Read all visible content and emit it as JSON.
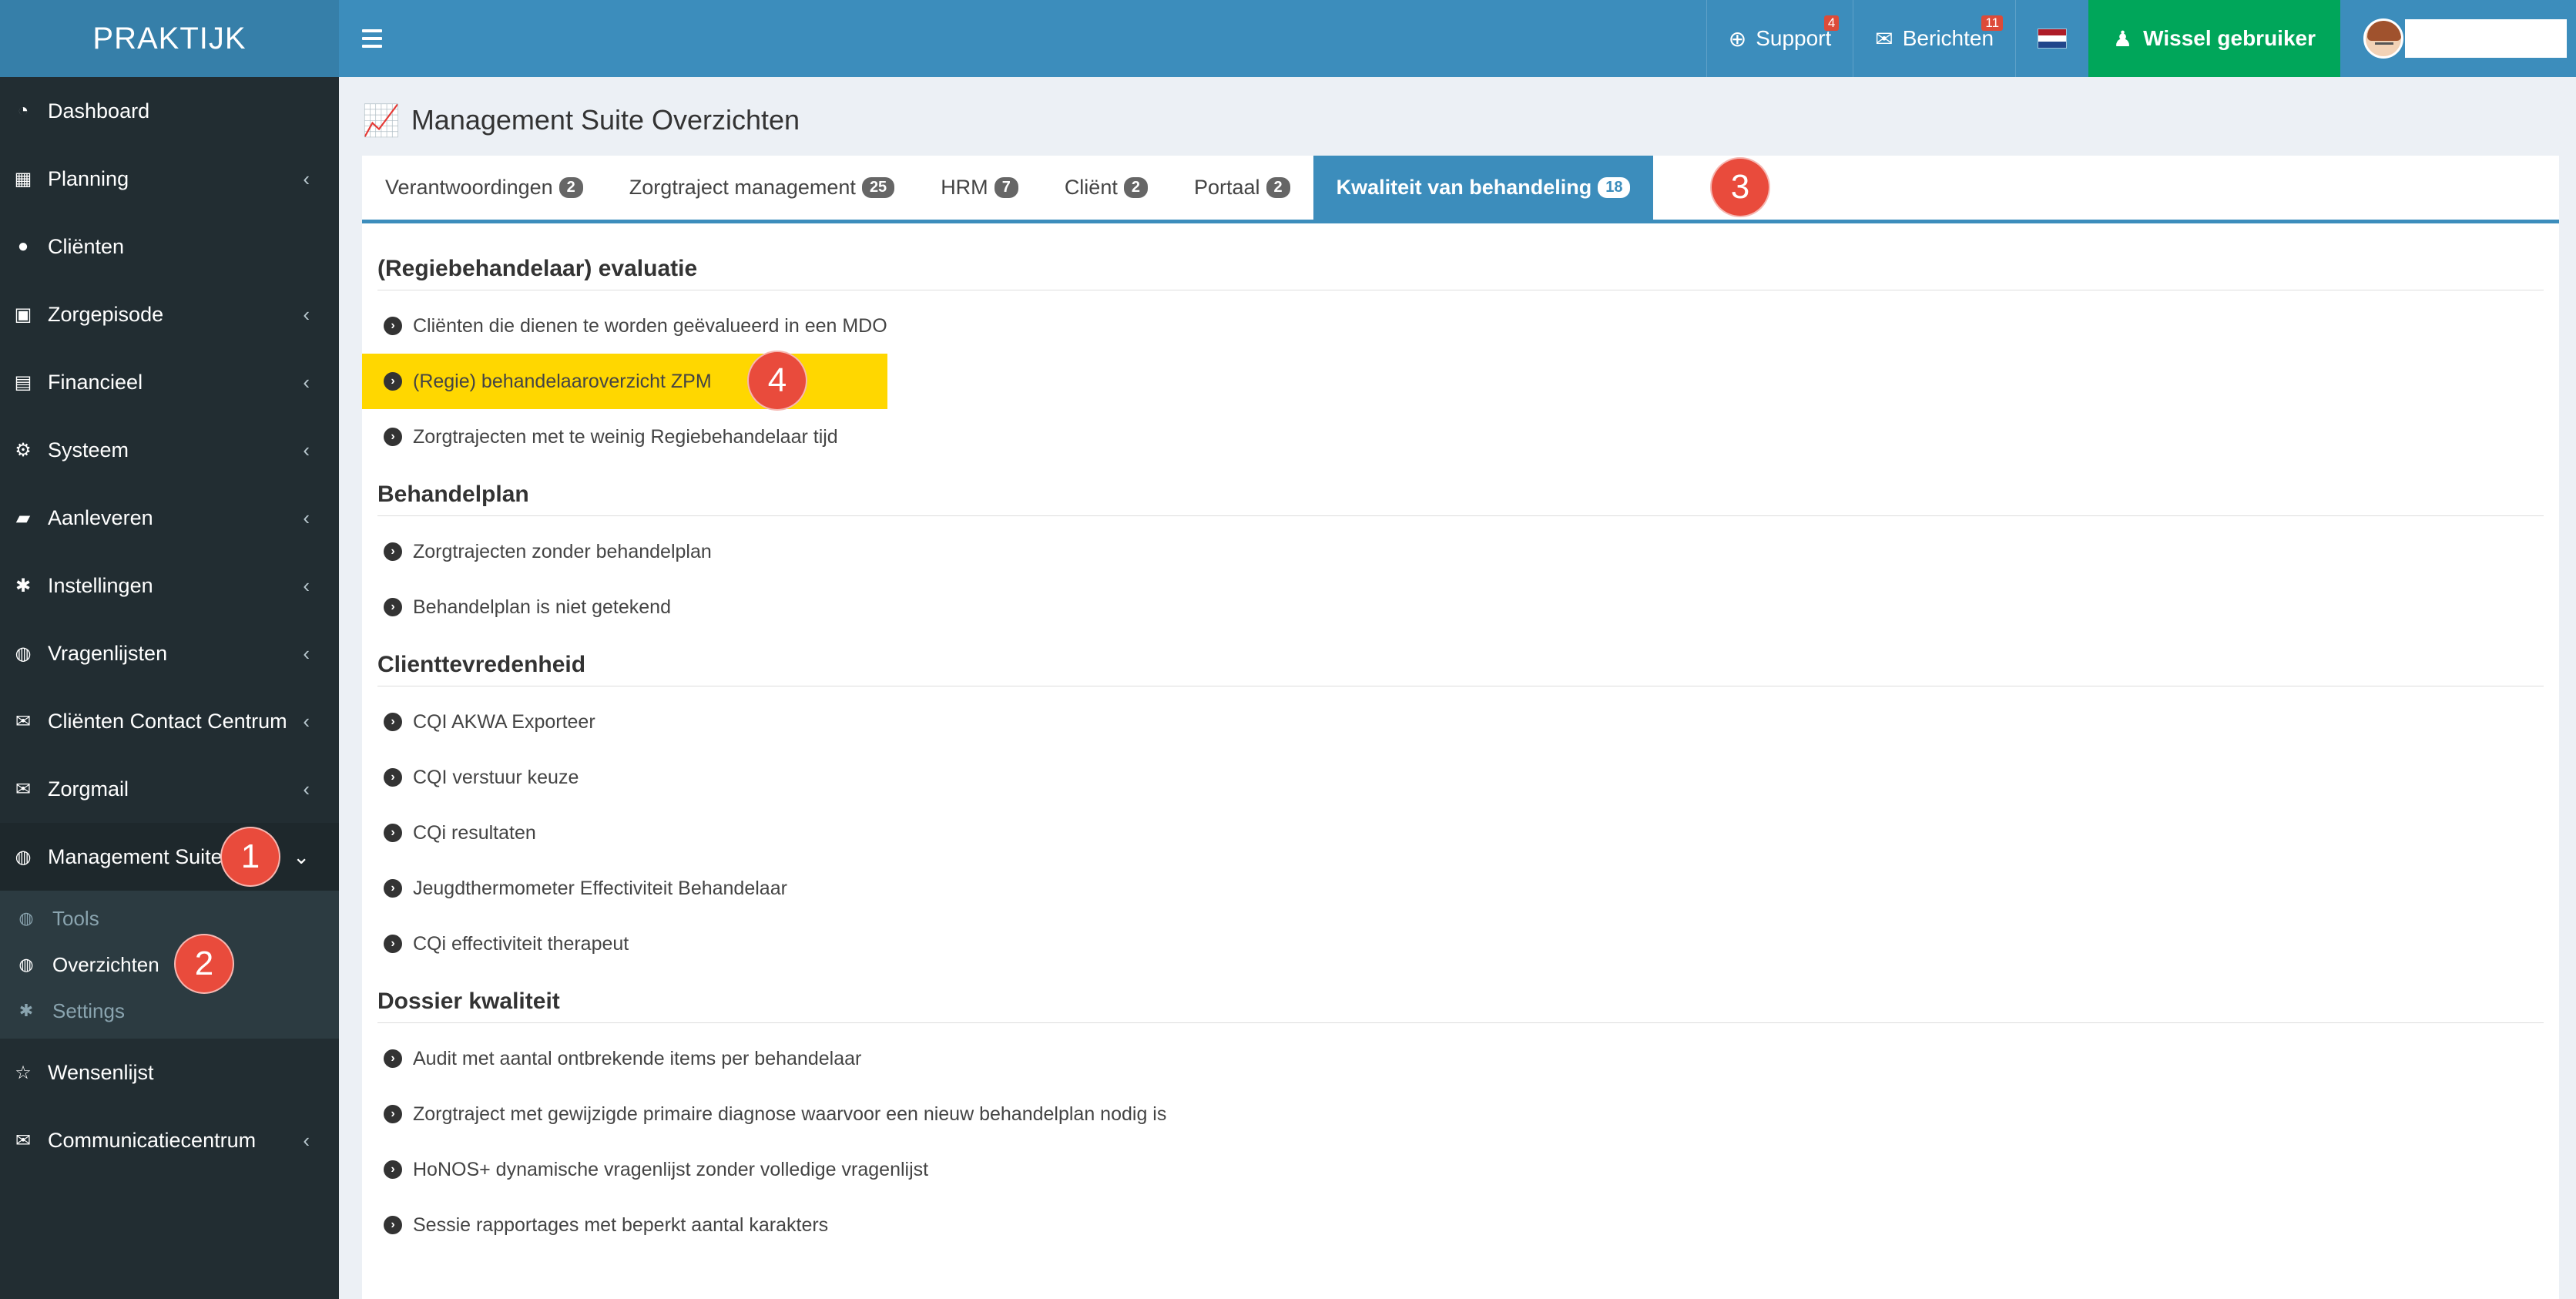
{
  "brand": "PRAKTIJK",
  "navbar": {
    "support_label": "Support",
    "support_badge": "4",
    "messages_label": "Berichten",
    "messages_badge": "11",
    "switch_user_label": "Wissel gebruiker",
    "colors": {
      "bar": "#3c8dbc",
      "switch": "#00a65a",
      "badge": "#dd4b39"
    }
  },
  "sidebar": {
    "items": [
      {
        "label": "Dashboard",
        "icon": "dashboard-icon"
      },
      {
        "label": "Planning",
        "icon": "calendar-icon"
      },
      {
        "label": "Cliënten",
        "icon": "user-icon"
      },
      {
        "label": "Zorgepisode",
        "icon": "suitcase-icon"
      },
      {
        "label": "Financieel",
        "icon": "book-icon"
      },
      {
        "label": "Systeem",
        "icon": "cogs-icon"
      },
      {
        "label": "Aanleveren",
        "icon": "truck-icon"
      },
      {
        "label": "Instellingen",
        "icon": "gear-icon"
      },
      {
        "label": "Vragenlijsten",
        "icon": "globe-icon"
      },
      {
        "label": "Cliënten Contact Centrum",
        "icon": "envelope-icon"
      },
      {
        "label": "Zorgmail",
        "icon": "envelope-icon"
      },
      {
        "label": "Management Suite",
        "icon": "globe-icon"
      }
    ],
    "submenu": [
      {
        "label": "Tools"
      },
      {
        "label": "Overzichten"
      },
      {
        "label": "Settings"
      }
    ],
    "after": [
      {
        "label": "Wensenlijst",
        "icon": "star-icon"
      },
      {
        "label": "Communicatiecentrum",
        "icon": "envelope-icon"
      }
    ]
  },
  "markers": {
    "m1": "1",
    "m2": "2",
    "m3": "3",
    "m4": "4"
  },
  "page_title": "Management Suite Overzichten",
  "tabs": [
    {
      "label": "Verantwoordingen",
      "count": "2"
    },
    {
      "label": "Zorgtraject management",
      "count": "25"
    },
    {
      "label": "HRM",
      "count": "7"
    },
    {
      "label": "Cliënt",
      "count": "2"
    },
    {
      "label": "Portaal",
      "count": "2"
    },
    {
      "label": "Kwaliteit van behandeling",
      "count": "18"
    }
  ],
  "sections": [
    {
      "title": "(Regiebehandelaar) evaluatie",
      "links": [
        "Cliënten die dienen te worden geëvalueerd in een MDO",
        "(Regie) behandelaaroverzicht ZPM",
        "Zorgtrajecten met te weinig Regiebehandelaar tijd"
      ]
    },
    {
      "title": "Behandelplan",
      "links": [
        "Zorgtrajecten zonder behandelplan",
        "Behandelplan is niet getekend"
      ]
    },
    {
      "title": "Clienttevredenheid",
      "links": [
        "CQI AKWA Exporteer",
        "CQI verstuur keuze",
        "CQi resultaten",
        "Jeugdthermometer Effectiviteit Behandelaar",
        "CQi effectiviteit therapeut"
      ]
    },
    {
      "title": "Dossier kwaliteit",
      "links": [
        "Audit met aantal ontbrekende items per behandelaar",
        "Zorgtraject met gewijzigde primaire diagnose waarvoor een nieuw behandelplan nodig is",
        "HoNOS+ dynamische vragenlijst zonder volledige vragenlijst",
        "Sessie rapportages met beperkt aantal karakters"
      ]
    }
  ]
}
